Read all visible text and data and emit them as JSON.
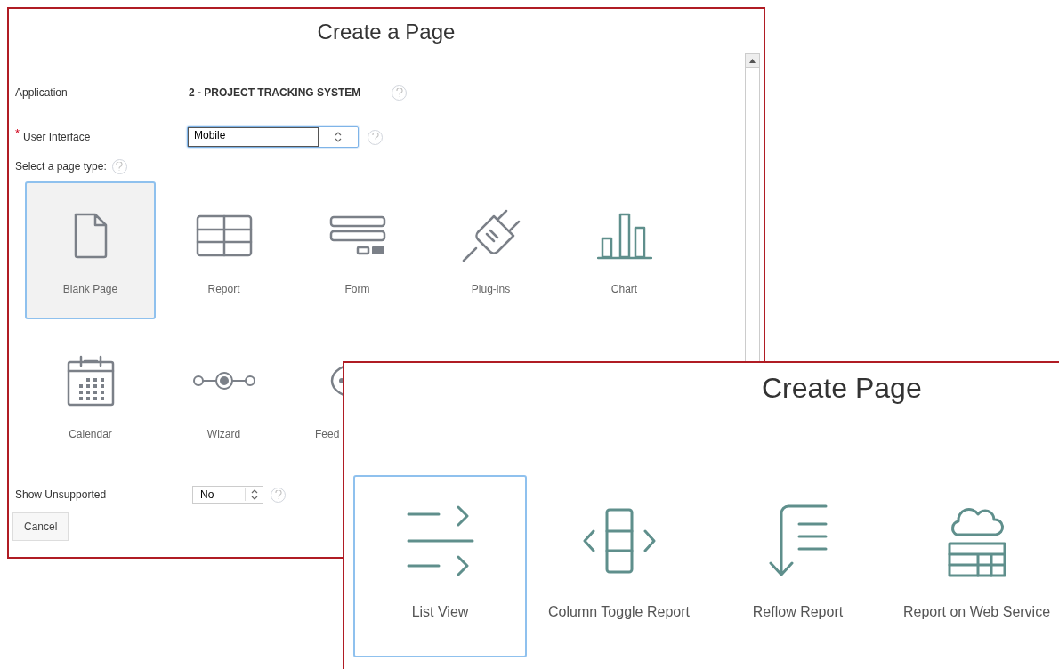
{
  "dialog_back": {
    "title": "Create a Page",
    "fields": [
      {
        "kind": "text",
        "label": "Application",
        "value": "2 - PROJECT TRACKING SYSTEM"
      },
      {
        "kind": "select",
        "label": "User Interface",
        "value": "Mobile",
        "required_mark": "*"
      }
    ],
    "page_type_label": "Select a page type:",
    "page_types": [
      {
        "kind": "blank",
        "label": "Blank Page",
        "selected": true
      },
      {
        "kind": "report",
        "label": "Report",
        "selected": false
      },
      {
        "kind": "form",
        "label": "Form",
        "selected": false
      },
      {
        "kind": "plugin",
        "label": "Plug-ins",
        "selected": false
      },
      {
        "kind": "chart",
        "label": "Chart",
        "selected": false
      },
      {
        "kind": "calendar",
        "label": "Calendar",
        "selected": false
      },
      {
        "kind": "wizard",
        "label": "Wizard",
        "selected": false
      },
      {
        "kind": "feedback",
        "label": "Feed",
        "selected": false
      }
    ],
    "show_unsupported": {
      "label": "Show Unsupported",
      "value": "No"
    },
    "cancel_button": "Cancel"
  },
  "dialog_front": {
    "title": "Create Page",
    "page_types": [
      {
        "kind": "listview",
        "label": "List View",
        "selected": true
      },
      {
        "kind": "columntoggle",
        "label": "Column Toggle Report",
        "selected": false
      },
      {
        "kind": "reflow",
        "label": "Reflow Report",
        "selected": false
      },
      {
        "kind": "webservice",
        "label": "Report on Web Service",
        "selected": false
      }
    ]
  }
}
